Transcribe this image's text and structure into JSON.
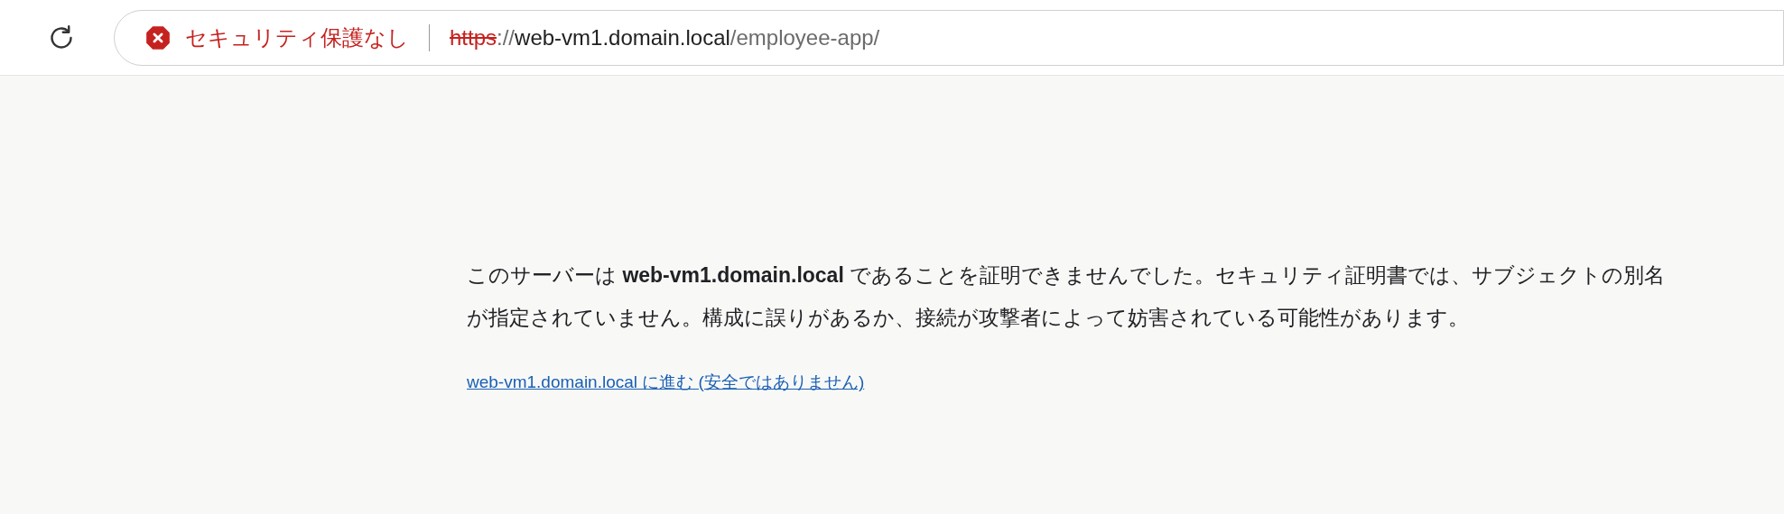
{
  "toolbar": {
    "security_status": "セキュリティ保護なし",
    "url": [
      {
        "kind": "scheme",
        "text": "https"
      },
      {
        "kind": "muted",
        "text": "://"
      },
      {
        "kind": "host",
        "text": "web-vm1.domain.local"
      },
      {
        "kind": "muted",
        "text": "/employee-app/"
      }
    ]
  },
  "error_page": {
    "message": "このサーバーは **web-vm1.domain.local** であることを証明できませんでした。セキュリティ証明書では、サブジェクトの別名が指定されていません。構成に誤りがあるか、接続が攻撃者によって妨害されている可能性があります。",
    "proceed_link": "web-vm1.domain.local に進む (安全ではありません)"
  }
}
